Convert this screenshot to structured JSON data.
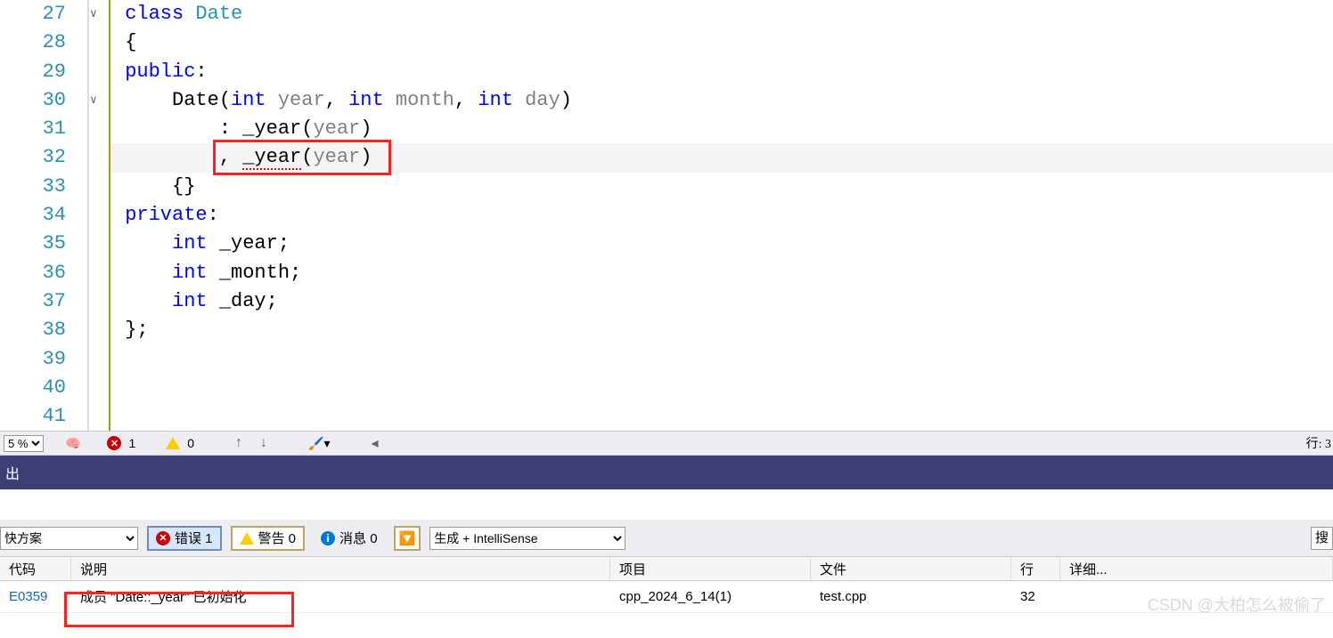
{
  "lines": [
    "27",
    "28",
    "29",
    "30",
    "31",
    "32",
    "33",
    "34",
    "35",
    "36",
    "37",
    "38",
    "39",
    "40",
    "41"
  ],
  "code": {
    "l27_kw": "class",
    "l27_cls": "Date",
    "l28": "{",
    "l29_kw": "public",
    "l29_c": ":",
    "l30_cls": "Date",
    "l30_p1": "(",
    "l30_t1": "int",
    "l30_a1": "year",
    "l30_c1": ", ",
    "l30_t2": "int",
    "l30_a2": "month",
    "l30_c2": ", ",
    "l30_t3": "int",
    "l30_a3": "day",
    "l30_p2": ")",
    "l31": ": _year(",
    "l31_p": "year",
    "l31_e": ")",
    "l32": ", ",
    "l32_v": "_year",
    "l32_o": "(",
    "l32_p": "year",
    "l32_e": ")",
    "l33": "{}",
    "l34_kw": "private",
    "l34_c": ":",
    "l35_t": "int",
    "l35_v": " _year;",
    "l36_t": "int",
    "l36_v": " _month;",
    "l37_t": "int",
    "l37_v": " _day;",
    "l38": "};"
  },
  "toolbar": {
    "zoom": "5 %",
    "err_count": "1",
    "warn_count": "0",
    "line_label": "行: 3"
  },
  "tabHeader": "出",
  "filterBar": {
    "solution": "快方案",
    "errors": "错误 1",
    "warnings": "警告 0",
    "info": "消息 0",
    "source": "生成 + IntelliSense",
    "search": "搜"
  },
  "table": {
    "cols": {
      "code": "代码",
      "desc": "说明",
      "proj": "项目",
      "file": "文件",
      "line": "行",
      "det": "详细..."
    },
    "row": {
      "code": "E0359",
      "desc": "成员 \"Date::_year\" 已初始化",
      "proj": "cpp_2024_6_14(1)",
      "file": "test.cpp",
      "line": "32"
    }
  },
  "watermark": "CSDN @大柏怎么被偷了"
}
